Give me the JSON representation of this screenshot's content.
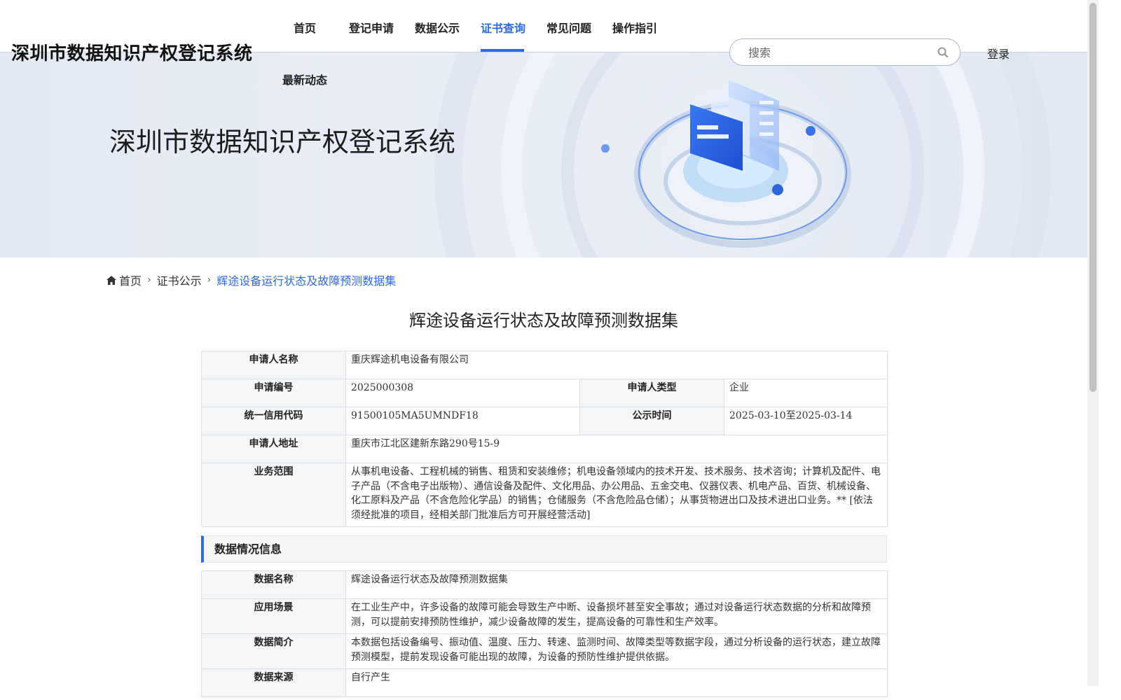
{
  "header": {
    "site_title": "深圳市数据知识产权登记系统",
    "nav": [
      "首页",
      "登记申请",
      "数据公示",
      "证书查询",
      "常见问题",
      "操作指引",
      "最新动态"
    ],
    "search_placeholder": "搜索",
    "login": "登录"
  },
  "banner": {
    "title": "深圳市数据知识产权登记系统"
  },
  "breadcrumb": {
    "home": "首页",
    "section": "证书公示",
    "current": "辉途设备运行状态及故障预测数据集"
  },
  "page_title": "辉途设备运行状态及故障预测数据集",
  "applicant": {
    "name_label": "申请人名称",
    "name": "重庆辉途机电设备有限公司",
    "number_label": "申请编号",
    "number": "2025000308",
    "type_label": "申请人类型",
    "type": "企业",
    "credit_label": "统一信用代码",
    "credit": "91500105MA5UMNDF18",
    "time_label": "公示时间",
    "time": "2025-03-10至2025-03-14",
    "address_label": "申请人地址",
    "address": "重庆市江北区建新东路290号15-9",
    "scope_label": "业务范围",
    "scope": "从事机电设备、工程机械的销售、租赁和安装维修；机电设备领域内的技术开发、技术服务、技术咨询；计算机及配件、电子产品（不含电子出版物）、通信设备及配件、文化用品、办公用品、五金交电、仪器仪表、机电产品、百货、机械设备、化工原料及产品（不含危险化学品）的销售；仓储服务（不含危险品仓储）；从事货物进出口及技术进出口业务。** [依法须经批准的项目，经相关部门批准后方可开展经营活动]"
  },
  "data_section": {
    "heading": "数据情况信息",
    "name_label": "数据名称",
    "name": "辉途设备运行状态及故障预测数据集",
    "scene_label": "应用场景",
    "scene": "在工业生产中，许多设备的故障可能会导致生产中断、设备损坏甚至安全事故；通过对设备运行状态数据的分析和故障预测，可以提前安排预防性维护，减少设备故障的发生，提高设备的可靠性和生产效率。",
    "intro_label": "数据简介",
    "intro": "本数据包括设备编号、振动值、温度、压力、转速、监测时间、故障类型等数据字段，通过分析设备的运行状态，建立故障预测模型，提前发现设备可能出现的故障，为设备的预防性维护提供依据。",
    "source_label": "数据来源",
    "source": "自行产生"
  },
  "colors": {
    "accent": "#2f6bd8",
    "label_bg": "#f5f6f7",
    "border": "#dcdfe6"
  }
}
